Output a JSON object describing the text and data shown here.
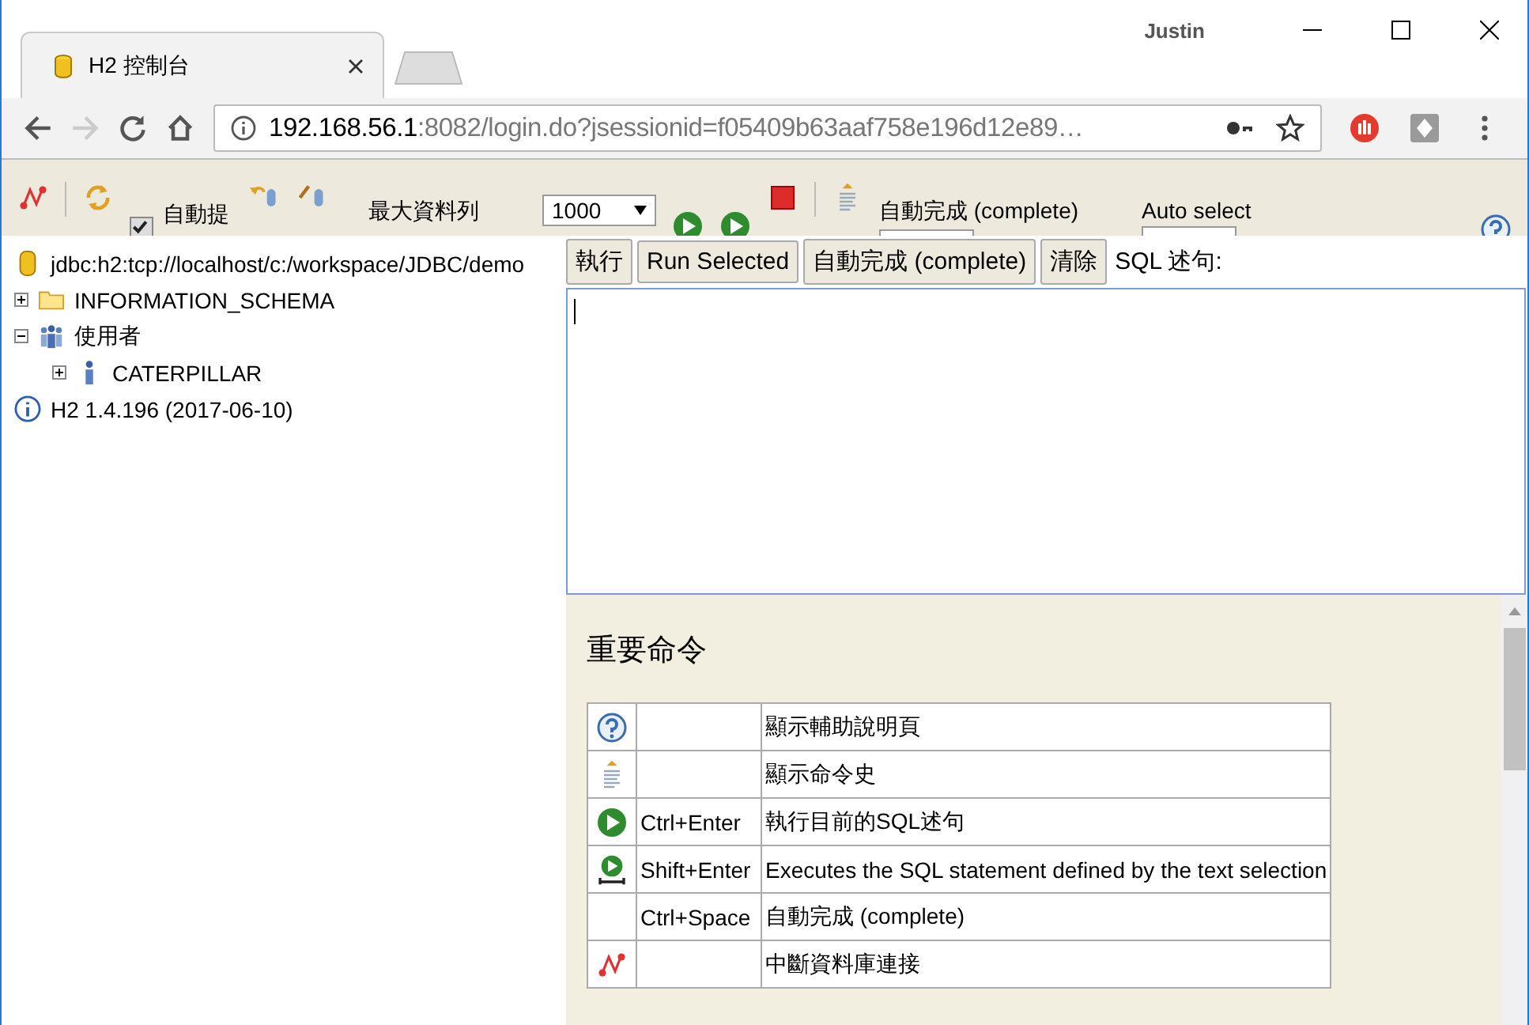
{
  "browser": {
    "profile": "Justin",
    "tab_title": "H2 控制台",
    "url_host": "192.168.56.1",
    "url_rest": ":8082/login.do?jsessionid=f05409b63aaf758e196d12e89…"
  },
  "toolbar": {
    "autocommit": {
      "label": "自動提",
      "checked": true
    },
    "max_rows": {
      "label": "最大資料列",
      "value": "1000"
    },
    "autocomplete_label": "自動完成 (complete)",
    "auto_select_label": "Auto select"
  },
  "tree": [
    {
      "kind": "connection",
      "label": "jdbc:h2:tcp://localhost/c:/workspace/JDBC/demo"
    },
    {
      "kind": "folder",
      "label": "INFORMATION_SCHEMA",
      "expanded": false
    },
    {
      "kind": "users",
      "label": "使用者",
      "expanded": true,
      "children": [
        {
          "kind": "user",
          "label": "CATERPILLAR",
          "expanded": false
        }
      ]
    },
    {
      "kind": "info",
      "label": "H2 1.4.196 (2017-06-10)"
    }
  ],
  "sql_buttons": [
    "執行",
    "Run Selected",
    "自動完成 (complete)",
    "清除"
  ],
  "sql_label": "SQL 述句:",
  "help": {
    "title": "重要命令",
    "rows": [
      {
        "kind": "help",
        "description": "顯示輔助說明頁"
      },
      {
        "kind": "history",
        "description": "顯示命令史"
      },
      {
        "kind": "run",
        "key": "Ctrl+Enter",
        "description": "執行目前的SQL述句"
      },
      {
        "kind": "run-selected",
        "key": "Shift+Enter",
        "description": "Executes the SQL statement defined by the text selection"
      },
      {
        "kind": "none",
        "key": "Ctrl+Space",
        "description": "自動完成 (complete)"
      },
      {
        "kind": "disconnect",
        "description": "中斷資料庫連接"
      }
    ]
  }
}
